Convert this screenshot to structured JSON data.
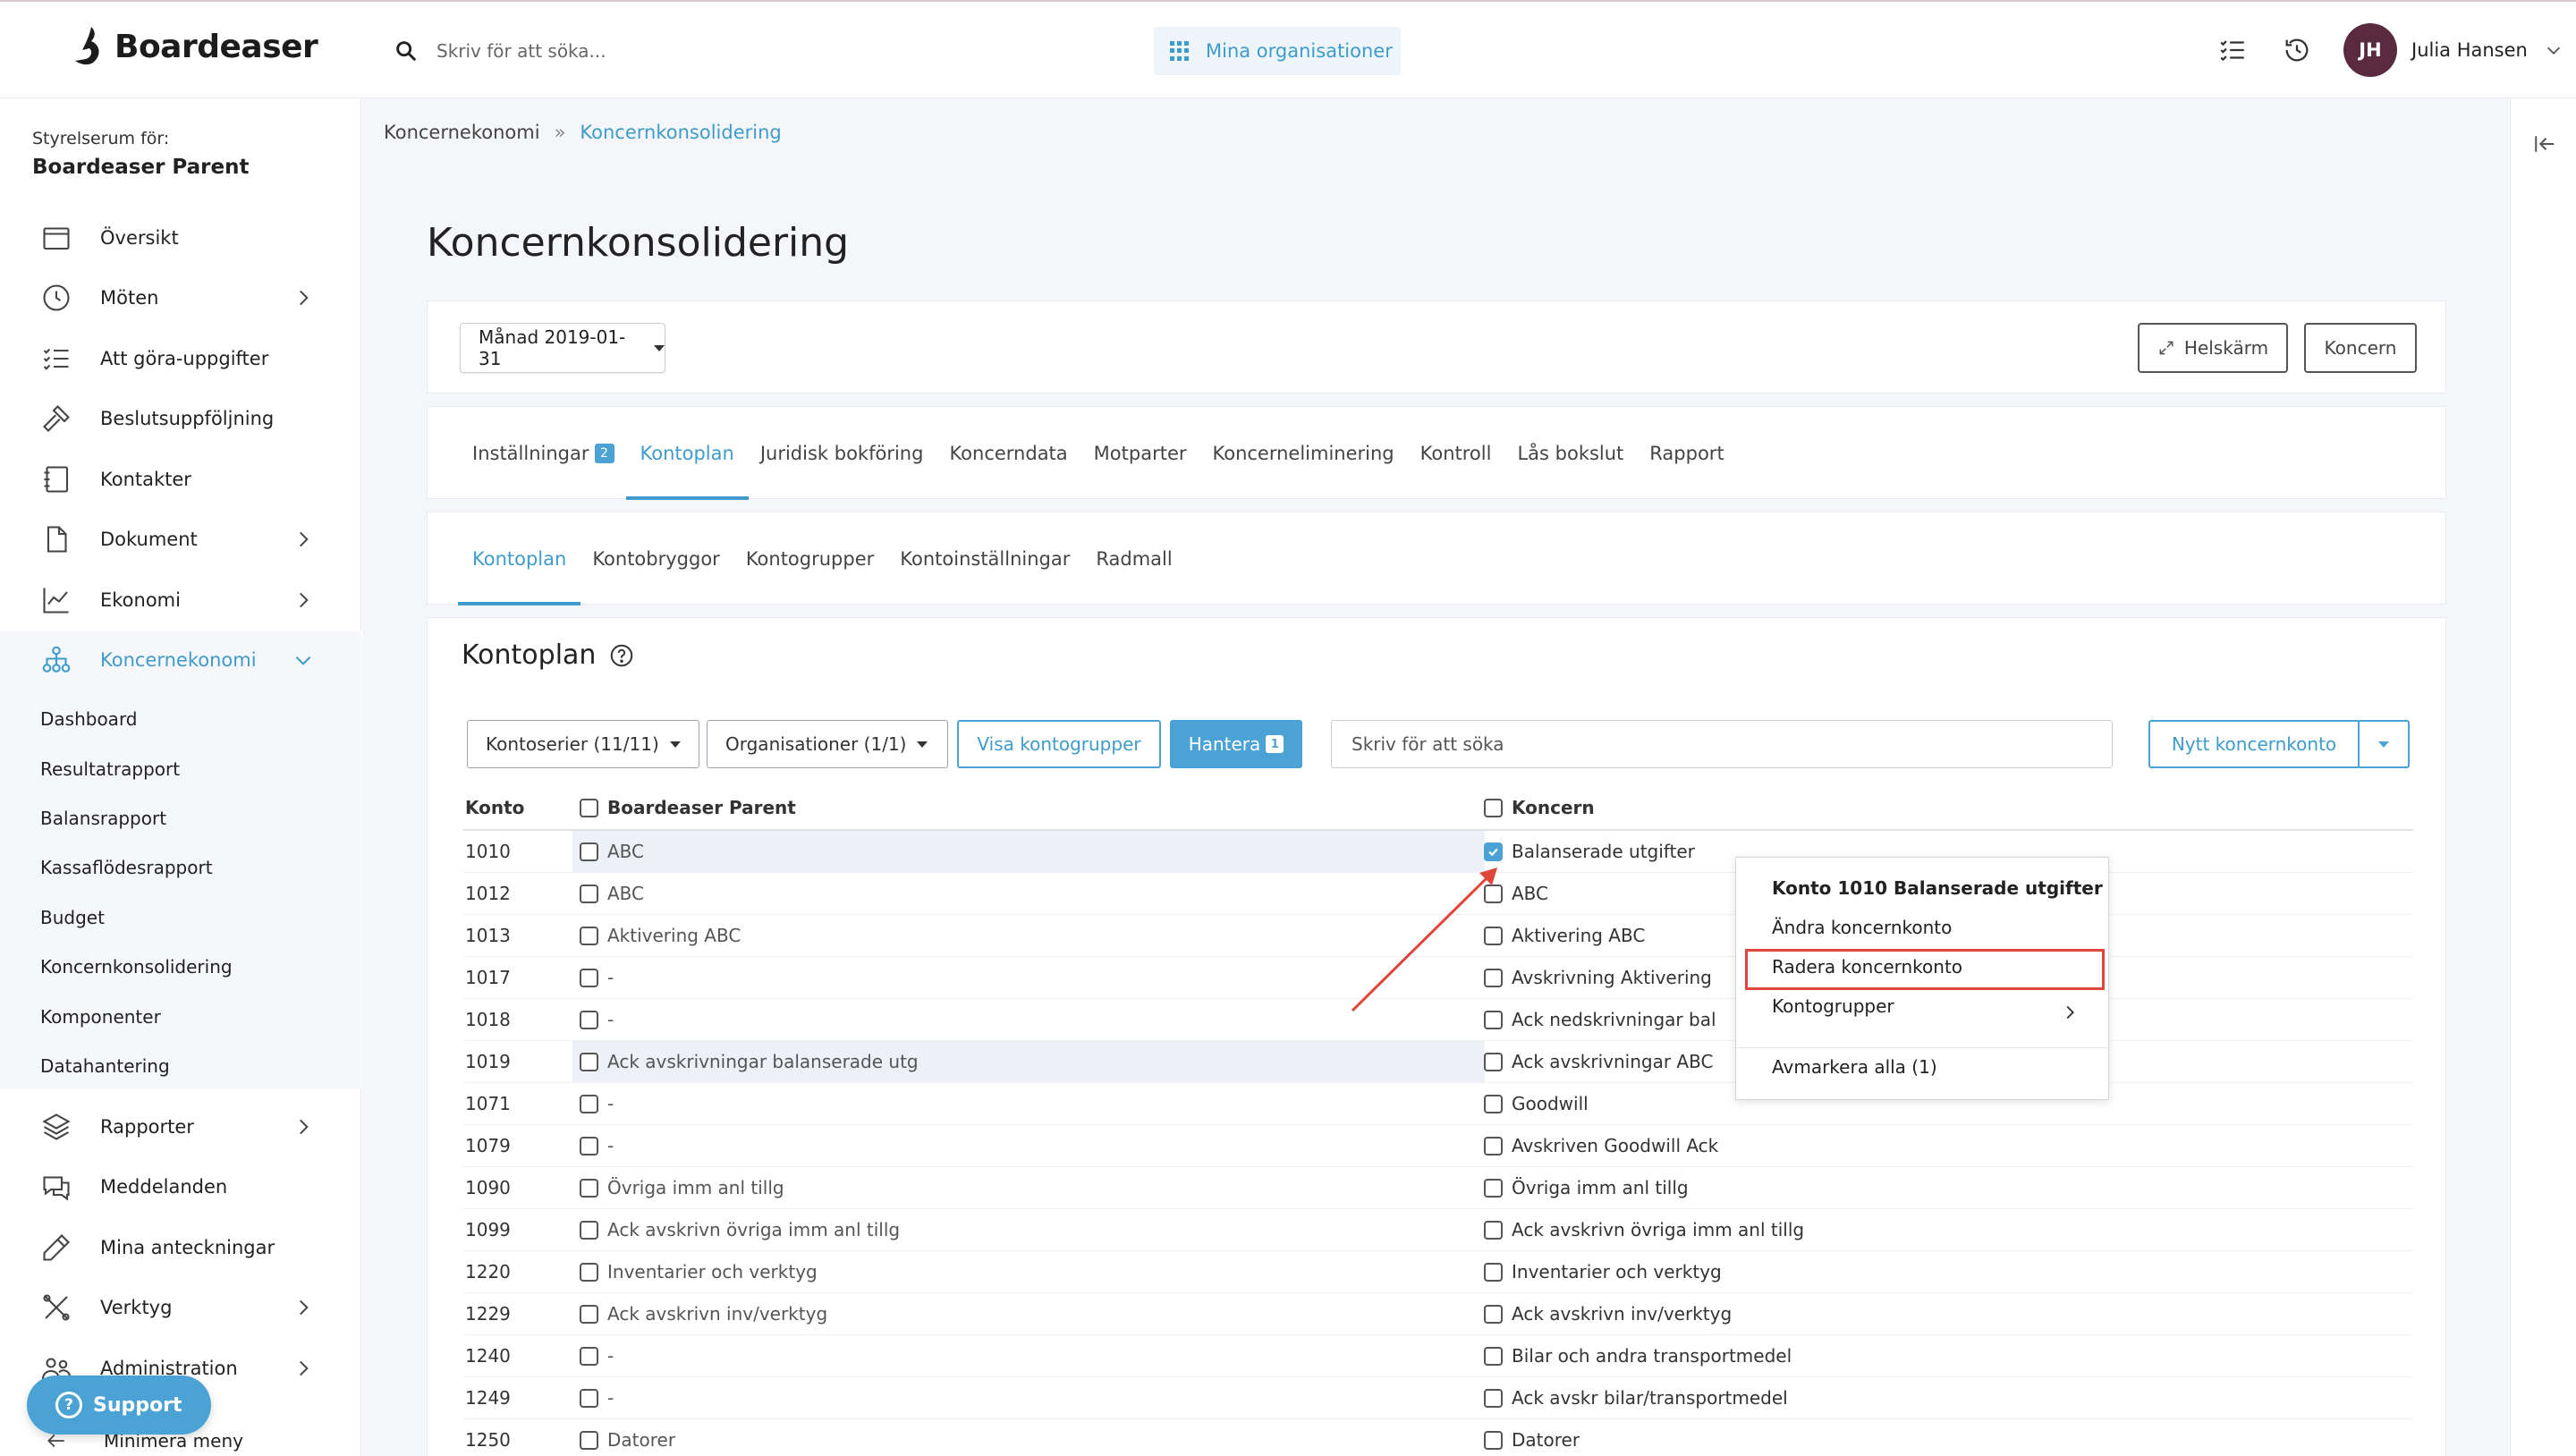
{
  "app": {
    "name": "Boardeaser",
    "search_placeholder": "Skriv för att söka...",
    "org_button": "Mina organisationer",
    "user": {
      "initials": "JH",
      "name": "Julia Hansen"
    },
    "colors": {
      "accent": "#4aa3d4",
      "avatar": "#5a2b3f",
      "highlight": "#e0453a"
    }
  },
  "sidebar": {
    "room_label": "Styrelserum för:",
    "room_name": "Boardeaser Parent",
    "items": [
      {
        "label": "Översikt",
        "icon": "calendar-icon"
      },
      {
        "label": "Möten",
        "icon": "clock-icon"
      },
      {
        "label": "Att göra-uppgifter",
        "icon": "checklist-icon"
      },
      {
        "label": "Beslutsuppföljning",
        "icon": "gavel-icon"
      },
      {
        "label": "Kontakter",
        "icon": "contacts-icon"
      },
      {
        "label": "Dokument",
        "icon": "document-icon"
      },
      {
        "label": "Ekonomi",
        "icon": "chart-icon"
      },
      {
        "label": "Koncernekonomi",
        "icon": "org-tree-icon"
      },
      {
        "label": "Rapporter",
        "icon": "layers-icon"
      },
      {
        "label": "Meddelanden",
        "icon": "chat-icon"
      },
      {
        "label": "Mina anteckningar",
        "icon": "pen-icon"
      },
      {
        "label": "Verktyg",
        "icon": "tools-icon"
      },
      {
        "label": "Administration",
        "icon": "users-icon"
      }
    ],
    "sub_items": [
      "Dashboard",
      "Resultatrapport",
      "Balansrapport",
      "Kassaflödesrapport",
      "Budget",
      "Koncernkonsolidering",
      "Komponenter",
      "Datahantering"
    ],
    "support": "Support",
    "minimize": "Minimera meny"
  },
  "breadcrumb": {
    "parent": "Koncernekonomi",
    "separator": "»",
    "current": "Koncernkonsolidering"
  },
  "page": {
    "title": "Koncernkonsolidering",
    "month": "Månad 2019-01-31",
    "fullscreen": "Helskärm",
    "koncern": "Koncern"
  },
  "tabs_main": [
    {
      "label": "Inställningar",
      "badge": "2"
    },
    {
      "label": "Kontoplan"
    },
    {
      "label": "Juridisk bokföring"
    },
    {
      "label": "Koncerndata"
    },
    {
      "label": "Motparter"
    },
    {
      "label": "Koncerneliminering"
    },
    {
      "label": "Kontroll"
    },
    {
      "label": "Lås bokslut"
    },
    {
      "label": "Rapport"
    }
  ],
  "tabs_sub": [
    "Kontoplan",
    "Kontobryggor",
    "Kontogrupper",
    "Kontoinställningar",
    "Radmall"
  ],
  "kontoplan": {
    "title": "Kontoplan",
    "filter_series": "Kontoserier (11/11)",
    "filter_orgs": "Organisationer (1/1)",
    "show_groups": "Visa kontogrupper",
    "manage": "Hantera",
    "manage_badge": "1",
    "search_placeholder": "Skriv för att söka",
    "new_account": "Nytt koncernkonto",
    "columns": {
      "konto": "Konto",
      "parent": "Boardeaser Parent",
      "koncern": "Koncern"
    },
    "rows": [
      {
        "konto": "1010",
        "parent": "ABC",
        "koncern": "Balanserade utgifter",
        "checked": true,
        "hl": true
      },
      {
        "konto": "1012",
        "parent": "ABC",
        "koncern": "ABC"
      },
      {
        "konto": "1013",
        "parent": "Aktivering ABC",
        "koncern": "Aktivering ABC"
      },
      {
        "konto": "1017",
        "parent": "-",
        "koncern": "Avskrivning Aktivering"
      },
      {
        "konto": "1018",
        "parent": "-",
        "koncern": "Ack nedskrivningar bal"
      },
      {
        "konto": "1019",
        "parent": "Ack avskrivningar balanserade utg",
        "koncern": "Ack avskrivningar ABC",
        "hl": true
      },
      {
        "konto": "1071",
        "parent": "-",
        "koncern": "Goodwill"
      },
      {
        "konto": "1079",
        "parent": "-",
        "koncern": "Avskriven Goodwill Ack"
      },
      {
        "konto": "1090",
        "parent": "Övriga imm anl tillg",
        "koncern": "Övriga imm anl tillg"
      },
      {
        "konto": "1099",
        "parent": "Ack avskrivn övriga imm anl tillg",
        "koncern": "Ack avskrivn övriga imm anl tillg"
      },
      {
        "konto": "1220",
        "parent": "Inventarier och verktyg",
        "koncern": "Inventarier och verktyg"
      },
      {
        "konto": "1229",
        "parent": "Ack avskrivn inv/verktyg",
        "koncern": "Ack avskrivn inv/verktyg"
      },
      {
        "konto": "1240",
        "parent": "-",
        "koncern": "Bilar och andra transportmedel"
      },
      {
        "konto": "1249",
        "parent": "-",
        "koncern": "Ack avskr bilar/transportmedel"
      },
      {
        "konto": "1250",
        "parent": "Datorer",
        "koncern": "Datorer"
      }
    ]
  },
  "context_menu": {
    "title": "Konto 1010 Balanserade utgifter",
    "edit": "Ändra koncernkonto",
    "delete": "Radera koncernkonto",
    "groups": "Kontogrupper",
    "unselect": "Avmarkera alla (1)"
  }
}
